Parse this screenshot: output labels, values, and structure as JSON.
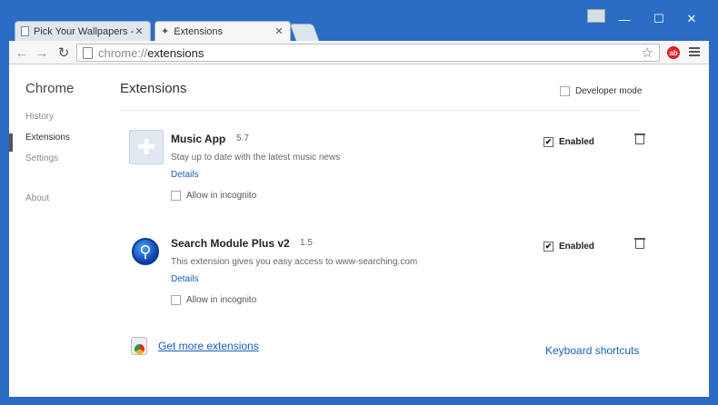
{
  "tabs": [
    {
      "label": "Pick Your Wallpapers - Fin",
      "icon": "page-icon"
    },
    {
      "label": "Extensions",
      "icon": "puzzle-icon"
    }
  ],
  "address": {
    "scheme": "chrome://",
    "path": "extensions"
  },
  "sidebar": {
    "title": "Chrome",
    "items": [
      {
        "label": "History"
      },
      {
        "label": "Extensions"
      },
      {
        "label": "Settings"
      },
      {
        "label": "About"
      }
    ]
  },
  "main": {
    "title": "Extensions",
    "developer_mode_label": "Developer mode"
  },
  "extensions": [
    {
      "name": "Music App",
      "version": "5.7",
      "description": "Stay up to date with the latest music news",
      "details_label": "Details",
      "incognito_label": "Allow in incognito",
      "enabled_label": "Enabled",
      "enabled": true,
      "icon": "puzzle-icon"
    },
    {
      "name": "Search Module Plus v2",
      "version": "1.5",
      "description": "This extension gives you easy access to www-searching.com",
      "details_label": "Details",
      "incognito_label": "Allow in incognito",
      "enabled_label": "Enabled",
      "enabled": true,
      "icon": "search-magnifier-icon"
    }
  ],
  "footer": {
    "get_more_label": "Get more extensions",
    "keyboard_shortcuts_label": "Keyboard shortcuts"
  },
  "colors": {
    "accent": "#2b6cc4",
    "link": "#1a5eb8",
    "badge": "#e02020"
  }
}
